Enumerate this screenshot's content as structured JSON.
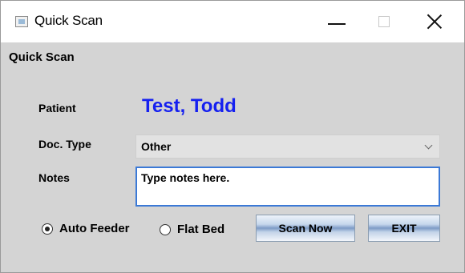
{
  "window": {
    "title": "Quick Scan",
    "icon": "scanner-app-icon"
  },
  "group": {
    "title": "Quick Scan"
  },
  "patient": {
    "label": "Patient",
    "name": "Test, Todd",
    "name_color": "#1520f0"
  },
  "doc_type": {
    "label": "Doc. Type",
    "selected": "Other"
  },
  "notes": {
    "label": "Notes",
    "value": "Type notes here.",
    "focus_color": "#3b79d6"
  },
  "source": {
    "options": [
      {
        "label": "Auto Feeder",
        "checked": true
      },
      {
        "label": "Flat Bed",
        "checked": false
      }
    ]
  },
  "buttons": {
    "scan": "Scan Now",
    "exit": "EXIT"
  }
}
